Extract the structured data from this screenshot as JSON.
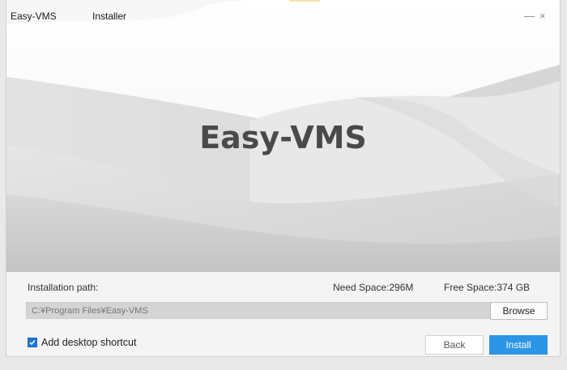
{
  "titlebar": {
    "app_name": "Easy-VMS",
    "installer_label": "Installer",
    "minimize_glyph": "—",
    "close_glyph": "×"
  },
  "hero": {
    "title": "Easy-VMS"
  },
  "install": {
    "path_label": "Installation path:",
    "need_space": "Need Space:296M",
    "free_space": "Free Space:374 GB",
    "path_value": "C:¥Program Files¥Easy-VMS",
    "browse_label": "Browse",
    "shortcut_label": "Add desktop shortcut",
    "shortcut_checked": true,
    "back_label": "Back",
    "install_label": "Install"
  },
  "colors": {
    "accent": "#2b95e6",
    "checkbox": "#1f78d1"
  },
  "icons": {
    "checkbox": "check-icon",
    "minimize": "minimize-icon",
    "close": "close-icon"
  }
}
